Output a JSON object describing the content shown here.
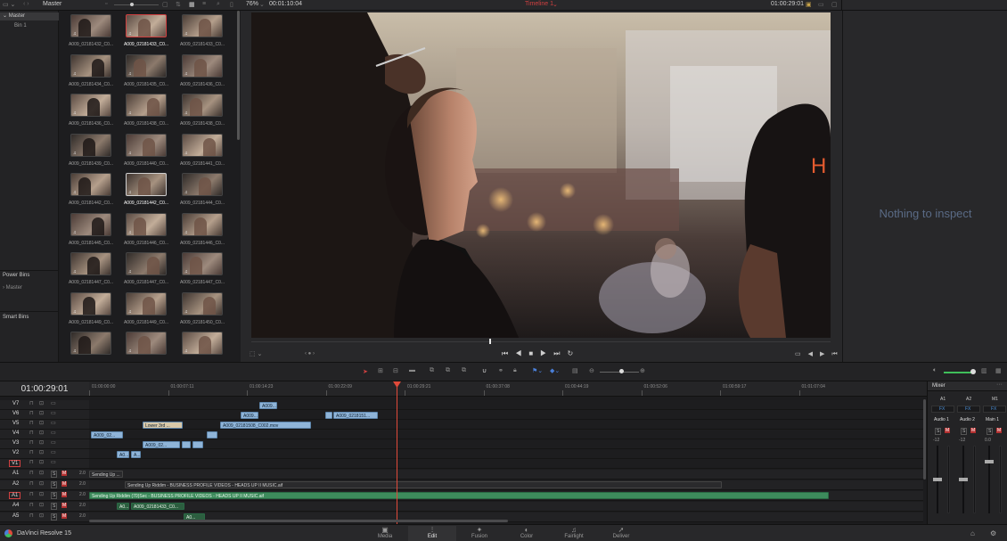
{
  "topbar": {
    "bin_name": "Master",
    "zoom": "76%",
    "timecode_in": "00:01:10:04",
    "timeline_name": "Timeline 1",
    "timecode_out": "01:00:29:01"
  },
  "bins": {
    "master": "Master",
    "bin1": "Bin 1",
    "power_bins": "Power Bins",
    "power_master": "Master",
    "smart_bins": "Smart Bins"
  },
  "clips": [
    "A009_02181432_C0...",
    "A009_02181433_C0...",
    "A009_02181433_C0...",
    "A009_02181434_C0...",
    "A009_02181435_C0...",
    "A009_02181436_C0...",
    "A009_02181436_C0...",
    "A009_02181438_C0...",
    "A009_02181438_C0...",
    "A009_02181439_C0...",
    "A009_02181440_C0...",
    "A009_02181441_C0...",
    "A009_02181442_C0...",
    "A009_02181442_C0...",
    "A009_02181444_C0...",
    "A009_02181445_C0...",
    "A009_02181446_C0...",
    "A009_02181446_C0...",
    "A009_02181447_C0...",
    "A009_02181447_C0...",
    "A009_02181447_C0...",
    "A009_02181449_C0...",
    "A009_02181449_C0...",
    "A009_02181450_C0...",
    "",
    "",
    ""
  ],
  "inspector": {
    "empty": "Nothing to inspect"
  },
  "timeline": {
    "current_tc": "01:00:29:01",
    "ruler": [
      "01:00:00:00",
      "01:00:07:11",
      "01:00:14:23",
      "01:00:22:09",
      "01:00:29:21",
      "01:00:37:08",
      "01:00:44:19",
      "01:00:52:06",
      "01:00:59:17",
      "01:01:07:04"
    ],
    "tracks": [
      {
        "id": "V7",
        "type": "video"
      },
      {
        "id": "V6",
        "type": "video"
      },
      {
        "id": "V5",
        "type": "video"
      },
      {
        "id": "V4",
        "type": "video"
      },
      {
        "id": "V3",
        "type": "video"
      },
      {
        "id": "V2",
        "type": "video"
      },
      {
        "id": "V1",
        "type": "video"
      },
      {
        "id": "A1",
        "type": "audio",
        "level": "2.0"
      },
      {
        "id": "A2",
        "type": "audio",
        "level": "2.0"
      },
      {
        "id": "A1",
        "type": "audio",
        "level": "2.0"
      },
      {
        "id": "A4",
        "type": "audio",
        "level": "2.0"
      },
      {
        "id": "A5",
        "type": "audio",
        "level": "2.0"
      }
    ],
    "clip_labels": {
      "v7a": "A009...",
      "v6a": "A009...",
      "v6b": "A009_0218151...",
      "v5a": "Lower 3rd ...",
      "v5b": "A009_02181508_C002.mov",
      "v4a": "A009_02...",
      "v3a": "A009_02...",
      "v2a": "A0...",
      "v2b": "A...",
      "a1a": "Sending Up ...",
      "a2a": "Sending Up Riddim - BUSINESS PROFILE VIDEOS - HEADS UP II MUSIC.aif",
      "a3a": "Sending Up Riddim (70)Sec - BUSINESS PROFILE VIDEOS - HEADS UP II MUSIC.aif",
      "a4a": "A0...",
      "a4b": "A009_02181433_C0...",
      "a5a": "A0..."
    }
  },
  "mixer": {
    "title": "Mixer",
    "ch": [
      "A1",
      "A2",
      "M1"
    ],
    "names": [
      "Audio 1",
      "Audio 2",
      "Main 1"
    ],
    "fx": "FX",
    "solo": "S",
    "mute": "M",
    "scale": [
      "-12",
      "-12",
      "0.0"
    ]
  },
  "bottombar": {
    "app": "DaVinci Resolve 15",
    "pages": [
      "Media",
      "Edit",
      "Fusion",
      "Color",
      "Fairlight",
      "Deliver"
    ],
    "active_page": "Edit"
  },
  "colors": {
    "accent_red": "#d04040",
    "video_clip": "#8fb4d8",
    "audio_clip": "#3d8b5c",
    "playhead": "#e04a3a"
  }
}
